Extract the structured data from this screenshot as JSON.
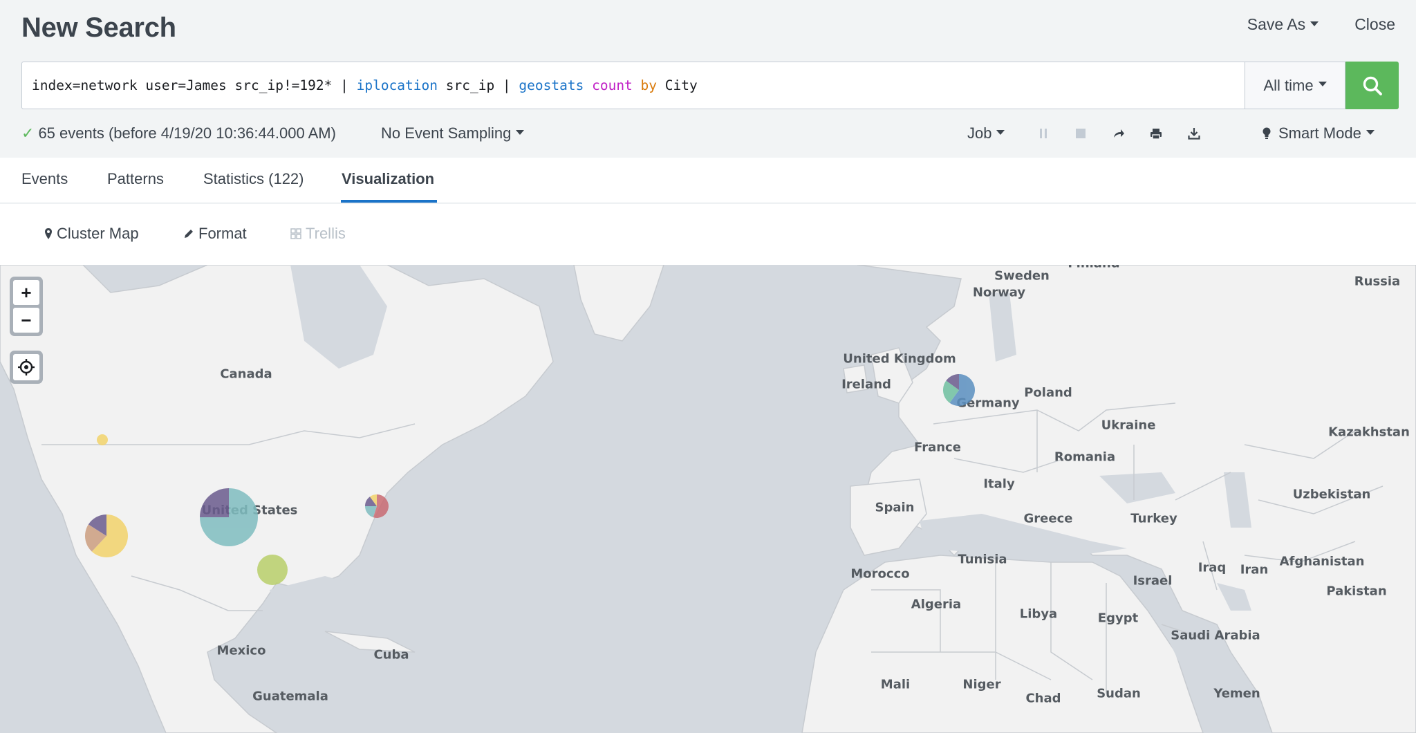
{
  "header": {
    "title": "New Search",
    "save_as_label": "Save As",
    "close_label": "Close"
  },
  "search": {
    "query_tokens": [
      {
        "text": "index=network user=James src_ip!=192* | ",
        "kind": "plain"
      },
      {
        "text": "iplocation",
        "kind": "cmd"
      },
      {
        "text": " src_ip | ",
        "kind": "plain"
      },
      {
        "text": "geostats",
        "kind": "cmd"
      },
      {
        "text": " ",
        "kind": "plain"
      },
      {
        "text": "count",
        "kind": "fn"
      },
      {
        "text": " ",
        "kind": "plain"
      },
      {
        "text": "by",
        "kind": "kw"
      },
      {
        "text": " City",
        "kind": "plain"
      }
    ],
    "time_range": "All time",
    "search_icon": "search-icon"
  },
  "status": {
    "events_text": "65 events (before 4/19/20 10:36:44.000 AM)",
    "sampling_label": "No Event Sampling",
    "job_label": "Job",
    "mode_label": "Smart Mode"
  },
  "tabs": [
    {
      "label": "Events",
      "active": false
    },
    {
      "label": "Patterns",
      "active": false
    },
    {
      "label": "Statistics (122)",
      "active": false
    },
    {
      "label": "Visualization",
      "active": true
    }
  ],
  "viz_toolbar": {
    "type_label": "Cluster Map",
    "format_label": "Format",
    "trellis_label": "Trellis"
  },
  "map": {
    "labels": [
      "Sweden",
      "Finland",
      "Norway",
      "Russia",
      "Canada",
      "United Kingdom",
      "Ireland",
      "Poland",
      "Germany",
      "Ukraine",
      "Kazakhstan",
      "France",
      "Romania",
      "Italy",
      "Uzbekistan",
      "United States",
      "Spain",
      "Greece",
      "Turkey",
      "Tunisia",
      "Morocco",
      "Iraq",
      "Iran",
      "Afghanistan",
      "Israel",
      "Pakistan",
      "Algeria",
      "Libya",
      "Egypt",
      "Saudi Arabia",
      "Mexico",
      "Cuba",
      "Mali",
      "Niger",
      "Chad",
      "Sudan",
      "Yemen",
      "Guatemala"
    ],
    "colors": {
      "ocean": "#d4d9df",
      "land": "#f2f2f2",
      "border": "#c7cbd0",
      "series": [
        "#7fbdc0",
        "#6a5b8e",
        "#f2d36b",
        "#b8cf6a",
        "#c96b73",
        "#cc9e80",
        "#5a8fc0",
        "#6fc0a0"
      ]
    }
  }
}
